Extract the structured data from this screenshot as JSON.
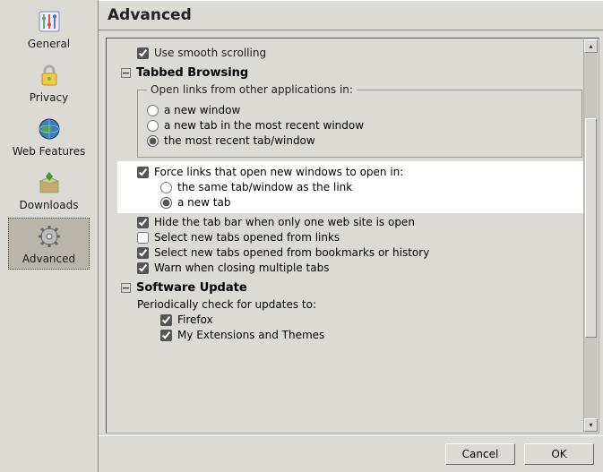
{
  "sidebar": {
    "items": [
      {
        "label": "General"
      },
      {
        "label": "Privacy"
      },
      {
        "label": "Web Features"
      },
      {
        "label": "Downloads"
      },
      {
        "label": "Advanced"
      }
    ]
  },
  "header": {
    "title": "Advanced"
  },
  "panel": {
    "smooth_scrolling": "Use smooth scrolling",
    "tabbed_browsing": "Tabbed Browsing",
    "open_links_legend": "Open links from other applications in:",
    "open_links": {
      "new_window": "a new window",
      "new_tab_recent": "a new tab in the most recent window",
      "most_recent": "the most recent tab/window"
    },
    "force_links": "Force links that open new windows to open in:",
    "force_options": {
      "same_tab": "the same tab/window as the link",
      "new_tab": "a new tab"
    },
    "hide_tab_bar": "Hide the tab bar when only one web site is open",
    "select_new_from_links": "Select new tabs opened from links",
    "select_new_from_bookmarks": "Select new tabs opened from bookmarks or history",
    "warn_closing": "Warn when closing multiple tabs",
    "software_update": "Software Update",
    "update_subhead": "Periodically check for updates to:",
    "update_firefox": "Firefox",
    "update_extensions": "My Extensions and Themes"
  },
  "footer": {
    "cancel": "Cancel",
    "ok": "OK"
  },
  "glyph": {
    "minus": "−",
    "up": "▴",
    "down": "▾"
  }
}
